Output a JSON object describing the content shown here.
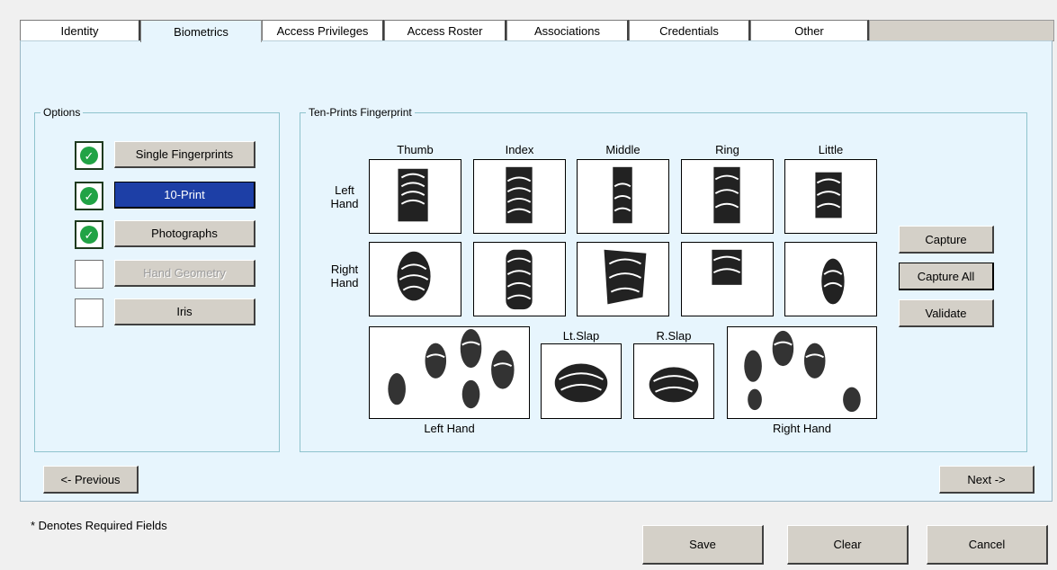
{
  "tabs": [
    {
      "label": "Identity"
    },
    {
      "label": "Biometrics"
    },
    {
      "label": "Access Privileges"
    },
    {
      "label": "Access Roster"
    },
    {
      "label": "Associations"
    },
    {
      "label": "Credentials"
    },
    {
      "label": "Other"
    }
  ],
  "active_tab": "Biometrics",
  "options": {
    "legend": "Options",
    "items": [
      {
        "label": "Single Fingerprints",
        "checked": true
      },
      {
        "label": "10-Print",
        "checked": true,
        "selected": true
      },
      {
        "label": "Photographs",
        "checked": true
      },
      {
        "label": "Hand Geometry",
        "checked": false,
        "disabled": true
      },
      {
        "label": "Iris",
        "checked": false
      }
    ]
  },
  "tenprint": {
    "legend": "Ten-Prints Fingerprint",
    "fingers": [
      "Thumb",
      "Index",
      "Middle",
      "Ring",
      "Little"
    ],
    "rows": [
      {
        "label": "Left Hand"
      },
      {
        "label": "Right Hand"
      }
    ],
    "slaps": {
      "left_hand": "Left Hand",
      "lt_slap": "Lt.Slap",
      "r_slap": "R.Slap",
      "right_hand": "Right Hand"
    },
    "actions": {
      "capture": "Capture",
      "capture_all": "Capture All",
      "validate": "Validate"
    }
  },
  "nav": {
    "previous": "<- Previous",
    "next": "Next ->"
  },
  "footer": {
    "required_note": "* Denotes Required Fields",
    "save": "Save",
    "clear": "Clear",
    "cancel": "Cancel"
  },
  "colors": {
    "panel_bg": "#e7f5fd",
    "selected_button": "#1d3fa6",
    "check_green": "#21a345"
  }
}
